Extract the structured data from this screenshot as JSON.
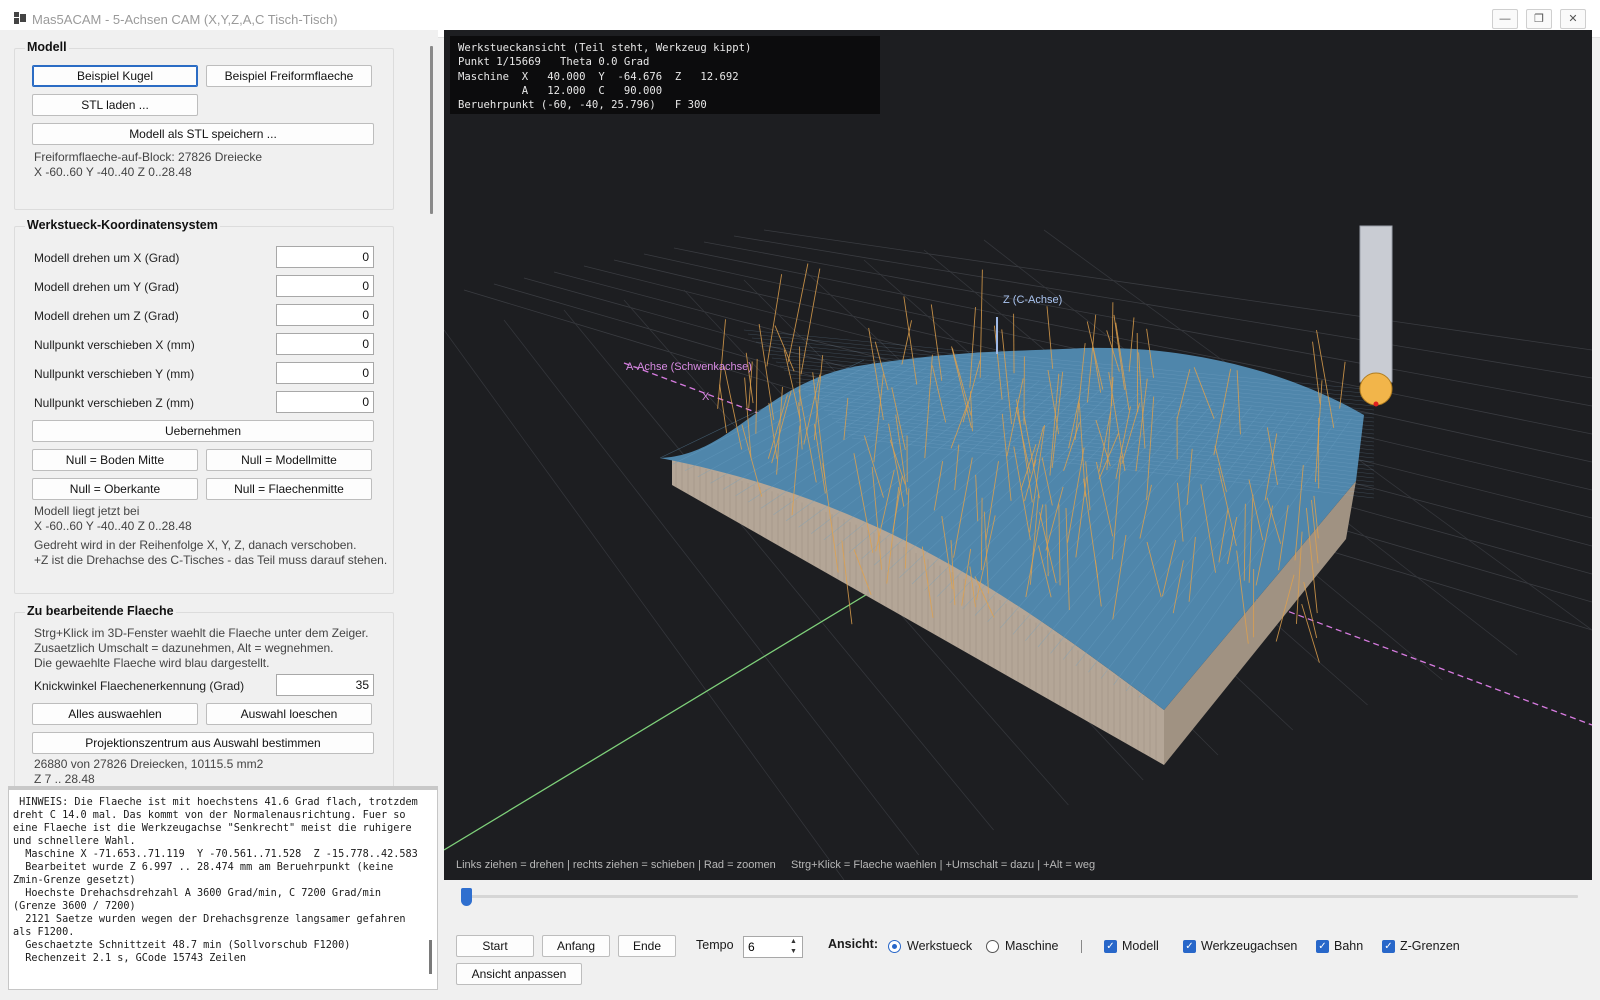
{
  "window": {
    "title": "Mas5ACAM - 5-Achsen CAM (X,Y,Z,A,C Tisch-Tisch)",
    "minimize": "—",
    "maximize": "❐",
    "close": "✕"
  },
  "modell": {
    "title": "Modell",
    "btn_kugel": "Beispiel Kugel",
    "btn_freiform": "Beispiel Freiformflaeche",
    "btn_stl_laden": "STL laden ...",
    "btn_stl_speichern": "Modell als STL speichern ...",
    "info_line1": "Freiformflaeche-auf-Block: 27826 Dreiecke",
    "info_line2": "X -60..60  Y -40..40  Z 0..28.48"
  },
  "koord": {
    "title": "Werkstueck-Koordinatensystem",
    "fields": [
      {
        "label": "Modell drehen um X (Grad)",
        "value": "0"
      },
      {
        "label": "Modell drehen um Y (Grad)",
        "value": "0"
      },
      {
        "label": "Modell drehen um Z (Grad)",
        "value": "0"
      },
      {
        "label": "Nullpunkt verschieben X (mm)",
        "value": "0"
      },
      {
        "label": "Nullpunkt verschieben Y (mm)",
        "value": "0"
      },
      {
        "label": "Nullpunkt verschieben Z (mm)",
        "value": "0"
      }
    ],
    "btn_uebernehmen": "Uebernehmen",
    "btn_boden_mitte": "Null = Boden Mitte",
    "btn_modellmitte": "Null = Modellmitte",
    "btn_oberkante": "Null = Oberkante",
    "btn_flaechenmitte": "Null = Flaechenmitte",
    "info_line1": "Modell liegt jetzt bei",
    "info_line2": "X -60..60   Y -40..40   Z 0..28.48",
    "info_line3": "Gedreht wird in der Reihenfolge X, Y, Z, danach verschoben.",
    "info_line4": "+Z ist die Drehachse des C-Tisches - das Teil muss darauf stehen."
  },
  "flaeche": {
    "title": "Zu bearbeitende Flaeche",
    "info_line1": "Strg+Klick im 3D-Fenster waehlt die Flaeche unter dem Zeiger.",
    "info_line2": "Zusaetzlich Umschalt = dazunehmen, Alt = wegnehmen.",
    "info_line3": "Die gewaehlte Flaeche wird blau dargestellt.",
    "knick_label": "Knickwinkel Flaechenerkennung (Grad)",
    "knick_value": "35",
    "btn_alles": "Alles auswaehlen",
    "btn_loeschen": "Auswahl loeschen",
    "btn_projektion": "Projektionszentrum aus Auswahl bestimmen",
    "sel_line1": "26880 von 27826 Dreiecken, 10115.5 mm2",
    "sel_line2": "Z 7 .. 28.48"
  },
  "log": {
    "lines": [
      " HINWEIS: Die Flaeche ist mit hoechstens 41.6 Grad flach, trotzdem",
      "dreht C 14.0 mal. Das kommt von der Normalenausrichtung. Fuer so",
      "eine Flaeche ist die Werkzeugachse \"Senkrecht\" meist die ruhigere",
      "und schnellere Wahl.",
      "  Maschine X -71.653..71.119  Y -70.561..71.528  Z -15.778..42.583",
      "  Bearbeitet wurde Z 6.997 .. 28.474 mm am Beruehrpunkt (keine",
      "Zmin-Grenze gesetzt)",
      "  Hoechste Drehachsdrehzahl A 3600 Grad/min, C 7200 Grad/min",
      "(Grenze 3600 / 7200)",
      "  2121 Saetze wurden wegen der Drehachsgrenze langsamer gefahren",
      "als F1200.",
      "  Geschaetzte Schnittzeit 48.7 min (Sollvorschub F1200)",
      "  Rechenzeit 2.1 s, GCode 15743 Zeilen"
    ]
  },
  "viewport": {
    "overlay": [
      "Werkstueckansicht (Teil steht, Werkzeug kippt)",
      "Punkt 1/15669   Theta 0.0 Grad",
      "Maschine  X   40.000  Y  -64.676  Z   12.692",
      "          A   12.000  C   90.000",
      "Beruehrpunkt (-60, -40, 25.796)   F 300"
    ],
    "label_z_achse": "Z (C-Achse)",
    "label_a_achse": "A-Achse (Schwenkachse)",
    "label_x": "X",
    "hint": "Links ziehen = drehen | rechts ziehen = schieben | Rad = zoomen     Strg+Klick = Flaeche waehlen | +Umschalt = dazu | +Alt = weg",
    "colors": {
      "background": "#1d1e21",
      "surface": "#4f86ab",
      "side": "#b5a89a",
      "toolpath": "#e0a14d",
      "tool": "#c9ccd3",
      "tool_tip": "#f2b54a",
      "a_axis": "#d77be0",
      "y_axis": "#7ed07a"
    }
  },
  "controls": {
    "slider_value": 0,
    "btn_start": "Start",
    "btn_anfang": "Anfang",
    "btn_ende": "Ende",
    "tempo_label": "Tempo",
    "tempo_value": "6",
    "ansicht_label": "Ansicht:",
    "radio_werkstueck": "Werkstueck",
    "radio_maschine": "Maschine",
    "cb_modell": "Modell",
    "cb_werkzeugachsen": "Werkzeugachsen",
    "cb_bahn": "Bahn",
    "cb_zgrenzen": "Z-Grenzen",
    "btn_ansicht_anpassen": "Ansicht anpassen"
  }
}
